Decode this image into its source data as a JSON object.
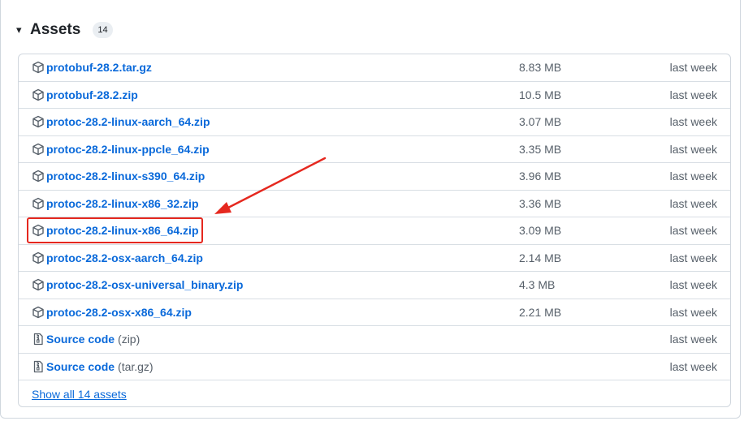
{
  "assets": {
    "title": "Assets",
    "count": "14",
    "caret": "▾",
    "accent_color": "#0969da",
    "annotation_color": "#e5281f",
    "items": [
      {
        "name": "protobuf-28.2.tar.gz",
        "size": "8.83 MB",
        "time": "last week",
        "icon": "package-icon"
      },
      {
        "name": "protobuf-28.2.zip",
        "size": "10.5 MB",
        "time": "last week",
        "icon": "package-icon"
      },
      {
        "name": "protoc-28.2-linux-aarch_64.zip",
        "size": "3.07 MB",
        "time": "last week",
        "icon": "package-icon"
      },
      {
        "name": "protoc-28.2-linux-ppcle_64.zip",
        "size": "3.35 MB",
        "time": "last week",
        "icon": "package-icon"
      },
      {
        "name": "protoc-28.2-linux-s390_64.zip",
        "size": "3.96 MB",
        "time": "last week",
        "icon": "package-icon"
      },
      {
        "name": "protoc-28.2-linux-x86_32.zip",
        "size": "3.36 MB",
        "time": "last week",
        "icon": "package-icon"
      },
      {
        "name": "protoc-28.2-linux-x86_64.zip",
        "size": "3.09 MB",
        "time": "last week",
        "icon": "package-icon",
        "highlighted": true
      },
      {
        "name": "protoc-28.2-osx-aarch_64.zip",
        "size": "2.14 MB",
        "time": "last week",
        "icon": "package-icon"
      },
      {
        "name": "protoc-28.2-osx-universal_binary.zip",
        "size": "4.3 MB",
        "time": "last week",
        "icon": "package-icon"
      },
      {
        "name": "protoc-28.2-osx-x86_64.zip",
        "size": "2.21 MB",
        "time": "last week",
        "icon": "package-icon"
      }
    ],
    "source_items": [
      {
        "name": "Source code",
        "suffix": "(zip)",
        "time": "last week",
        "icon": "file-zip-icon"
      },
      {
        "name": "Source code",
        "suffix": "(tar.gz)",
        "time": "last week",
        "icon": "file-zip-icon"
      }
    ],
    "show_all": "Show all 14 assets"
  }
}
